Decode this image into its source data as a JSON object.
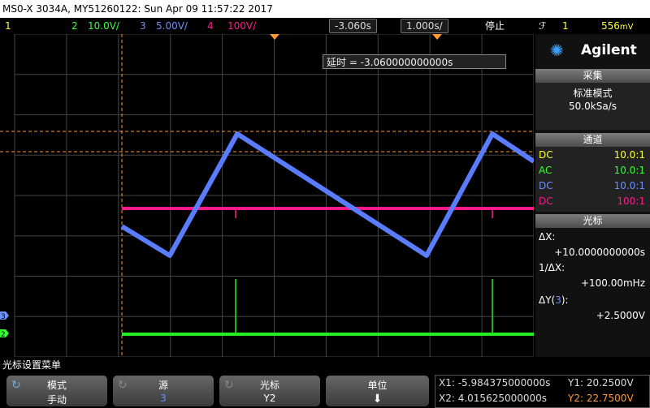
{
  "title": "MS0-X 3034A, MY51260122: Sun Apr 09 11:57:22 2017",
  "status": {
    "ch1_num": "1",
    "ch2_num": "2",
    "ch2_scale": "10.0V/",
    "ch3_num": "3",
    "ch3_scale": "5.00V/",
    "ch4_num": "4",
    "ch4_scale": "100V/",
    "delay": "-3.060s",
    "timebase": "1.000s/",
    "run_state": "停止",
    "trig_icon": "ℱ",
    "trig_src": "1",
    "trig_level": "556",
    "trig_unit": "mV"
  },
  "delay_tooltip": "延时 = -3.060000000000s",
  "panel": {
    "brand": "Agilent",
    "acq_header": "采集",
    "acq_mode": "标准模式",
    "acq_rate": "50.0kSa/s",
    "chan_header": "通道",
    "channels": [
      {
        "coupling": "DC",
        "probe": "10.0:1",
        "color": "#ffff33"
      },
      {
        "coupling": "AC",
        "probe": "10.0:1",
        "color": "#33ff33"
      },
      {
        "coupling": "DC",
        "probe": "10.0:1",
        "color": "#6f8fff"
      },
      {
        "coupling": "DC",
        "probe": "100:1",
        "color": "#ff1a8c"
      }
    ],
    "cursor_header": "光标",
    "dx_label": "ΔX:",
    "dx_value": "+10.0000000000s",
    "inv_dx_label": "1/ΔX:",
    "inv_dx_value": "+100.00mHz",
    "dy_label_pre": "ΔY(",
    "dy_label_num": "3",
    "dy_label_post": "):",
    "dy_value": "+2.5000V"
  },
  "menu_title": "光标设置菜单",
  "softkeys": [
    {
      "label": "模式",
      "value": "手动"
    },
    {
      "label": "源",
      "value": "3"
    },
    {
      "label": "光标",
      "value": "Y2"
    },
    {
      "label": "单位",
      "value": "⬇"
    }
  ],
  "readout": {
    "x1": "X1: -5.984375000000s",
    "y1": "Y1: 20.2500V",
    "x2": "X2: 4.015625000000s",
    "y2": "Y2: 22.7500V"
  },
  "colors": {
    "ch1": "#ffff33",
    "ch2": "#33ff33",
    "ch3": "#5a7cff",
    "ch4": "#ff1a8c",
    "cursor": "#ff9933",
    "accent": "#7ad"
  },
  "icons": {
    "rotary": "rotary-knob-icon",
    "down": "down-arrow-icon",
    "logo": "agilent-spark-icon"
  }
}
